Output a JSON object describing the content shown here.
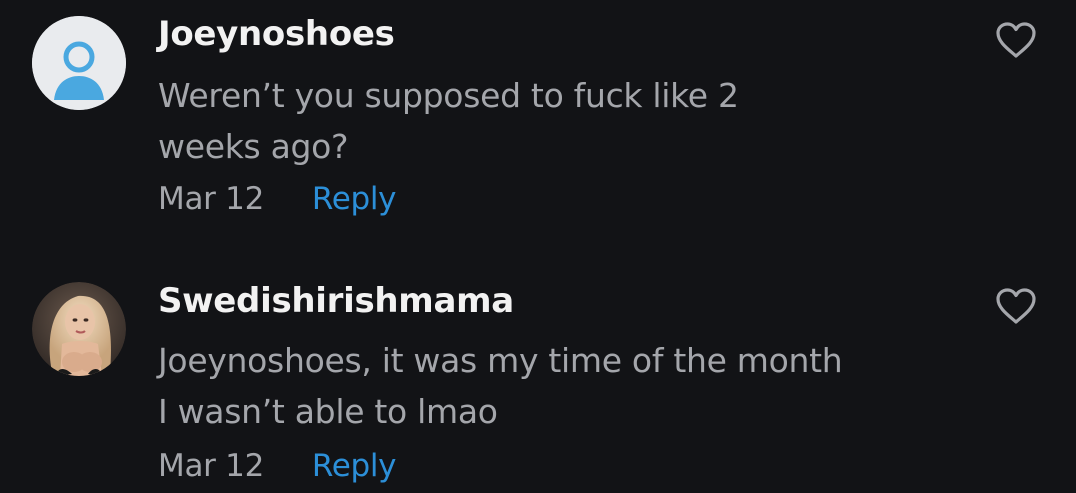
{
  "comments": [
    {
      "username": "Joeynoshoes",
      "avatar_icon": "default-user-icon",
      "lines": [
        "Weren’t you supposed to fuck like 2",
        "weeks ago?"
      ],
      "date": "Mar 12",
      "reply_label": "Reply",
      "like_icon": "heart-outline-icon"
    },
    {
      "username": "Swedishirishmama",
      "avatar_icon": "profile-photo",
      "lines": [
        "Joeynoshoes, it was my time of the month",
        "I wasn’t able to lmao"
      ],
      "date": "Mar 12",
      "reply_label": "Reply",
      "like_icon": "heart-outline-icon"
    }
  ],
  "colors": {
    "background": "#121316",
    "username": "#f2f2f2",
    "body_text": "#a4a6ab",
    "reply_link": "#2c8fd8",
    "icon_stroke": "#a4a6ab"
  }
}
